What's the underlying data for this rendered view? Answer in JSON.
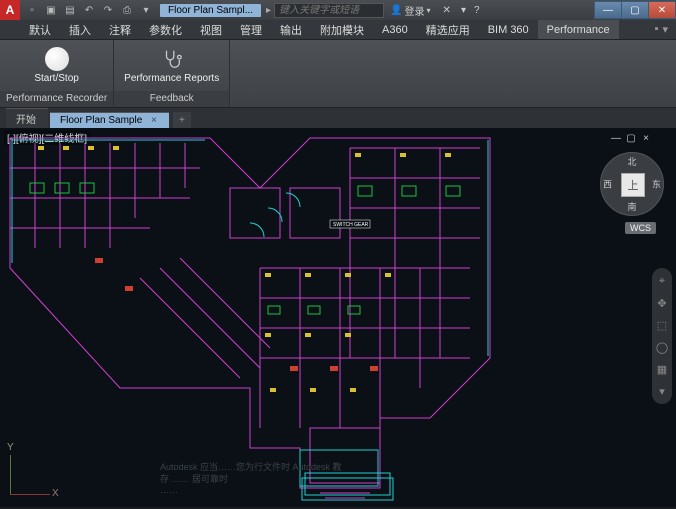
{
  "titlebar": {
    "doc_title": "Floor Plan Sampl...",
    "search_placeholder": "键入关键字或短语",
    "login_label": "登录",
    "logo_letter": "A"
  },
  "menutabs": {
    "items": [
      "默认",
      "插入",
      "注释",
      "参数化",
      "视图",
      "管理",
      "输出",
      "附加模块",
      "A360",
      "精选应用",
      "BIM 360",
      "Performance"
    ],
    "active_index": 11
  },
  "ribbon": {
    "panel1": {
      "btn_label": "Start/Stop",
      "footer": "Performance Recorder"
    },
    "panel2": {
      "btn_label": "Performance Reports",
      "footer": "Feedback"
    }
  },
  "filetabs": {
    "tabs": [
      {
        "label": "开始",
        "active": false
      },
      {
        "label": "Floor Plan Sample",
        "active": true
      }
    ]
  },
  "viewport": {
    "label": "[-][俯视][二维线框]",
    "ucs": {
      "x": "X",
      "y": "Y"
    }
  },
  "viewcube": {
    "face": "上",
    "n": "北",
    "s": "南",
    "e": "东",
    "w": "西",
    "wcs": "WCS"
  },
  "watermark_lines": [
    "Autodesk 应当……您为行文件时 Autodesk 教",
    "存 …… 居可靠时",
    "……"
  ]
}
